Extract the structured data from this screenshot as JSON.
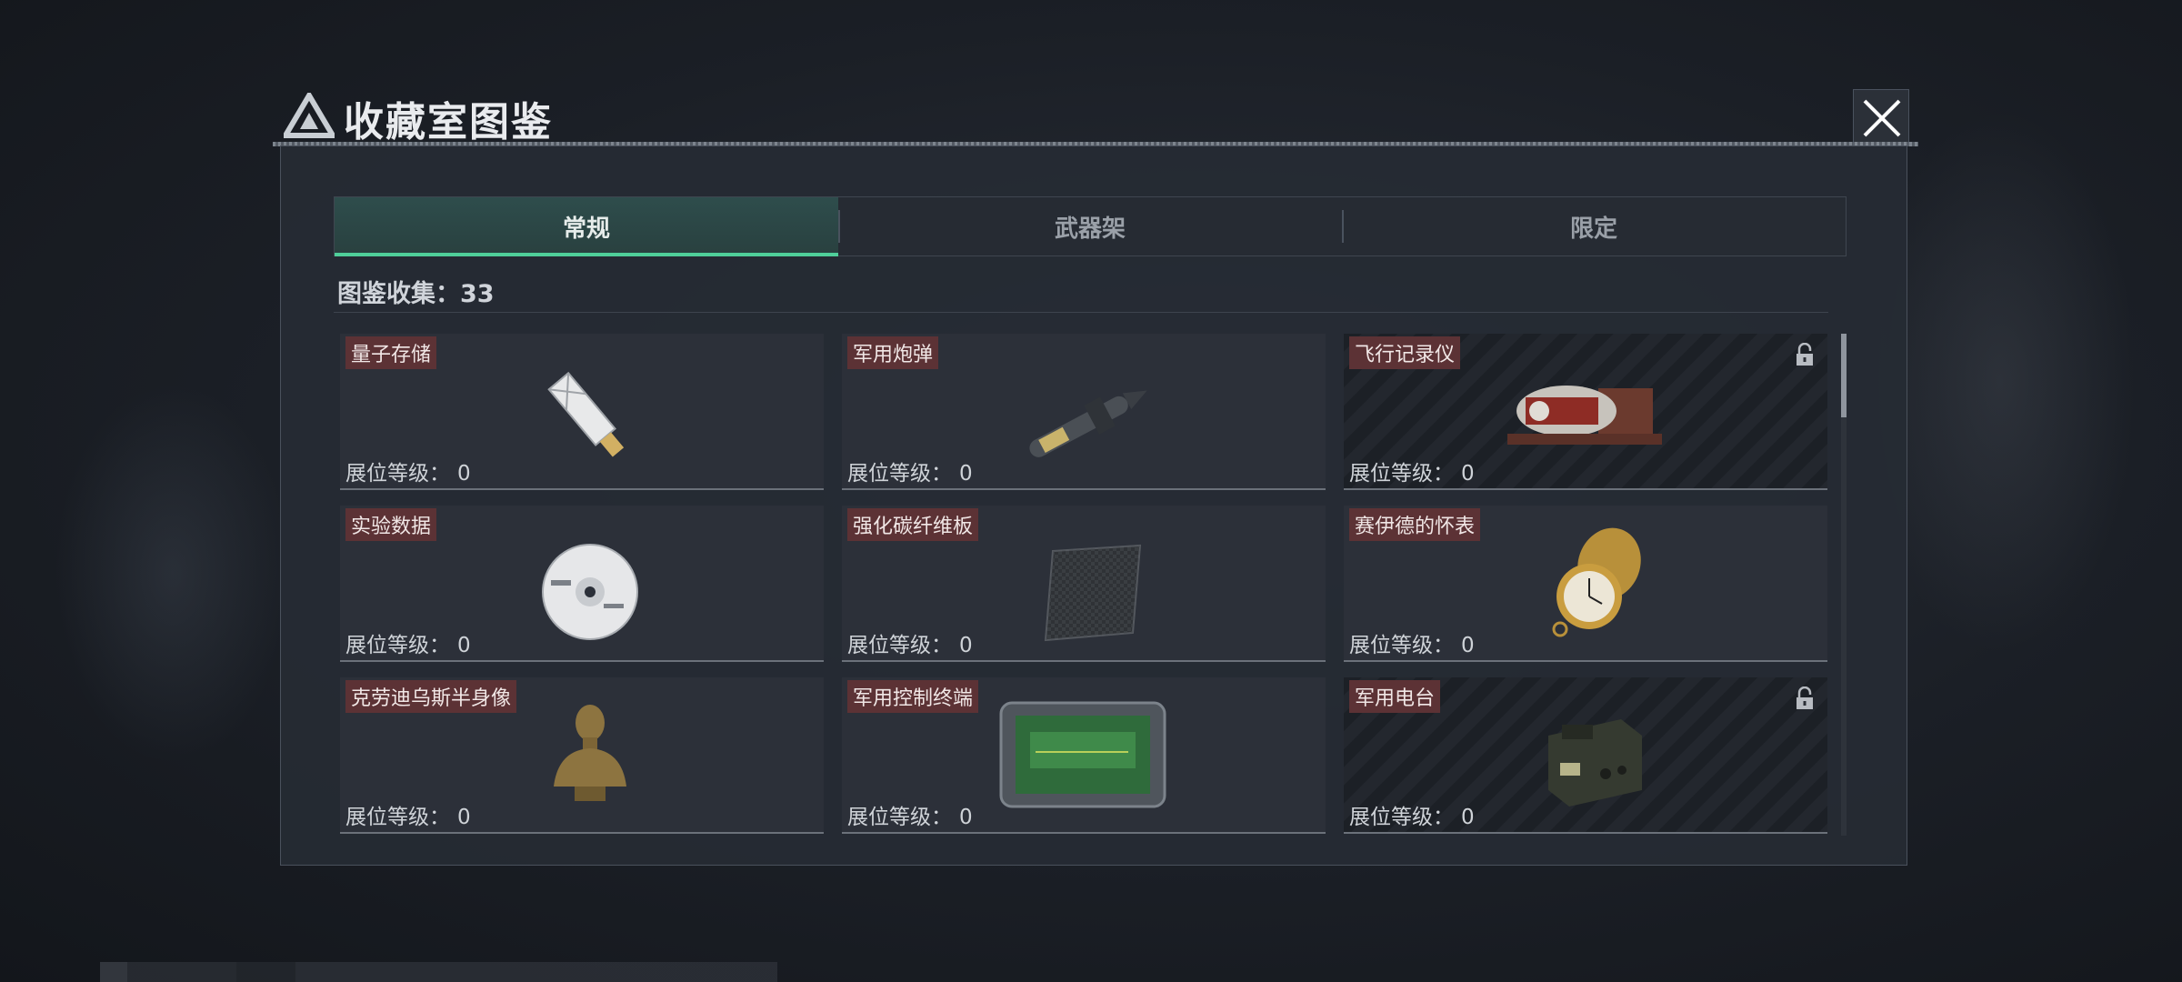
{
  "window": {
    "title": "收藏室图鉴",
    "close_icon": "close-icon"
  },
  "tabs": [
    {
      "label": "常规",
      "active": true
    },
    {
      "label": "武器架",
      "active": false
    },
    {
      "label": "限定",
      "active": false
    }
  ],
  "collection": {
    "label": "图鉴收集：33"
  },
  "items": [
    {
      "name": "量子存储",
      "level_label": "展位等级：",
      "level": "0",
      "locked": false,
      "icon": "usb-drive-icon"
    },
    {
      "name": "军用炮弹",
      "level_label": "展位等级：",
      "level": "0",
      "locked": false,
      "icon": "shell-icon"
    },
    {
      "name": "飞行记录仪",
      "level_label": "展位等级：",
      "level": "0",
      "locked": true,
      "icon": "flight-recorder-icon"
    },
    {
      "name": "实验数据",
      "level_label": "展位等级：",
      "level": "0",
      "locked": false,
      "icon": "disc-icon"
    },
    {
      "name": "强化碳纤维板",
      "level_label": "展位等级：",
      "level": "0",
      "locked": false,
      "icon": "carbon-plate-icon"
    },
    {
      "name": "赛伊德的怀表",
      "level_label": "展位等级：",
      "level": "0",
      "locked": false,
      "icon": "pocket-watch-icon"
    },
    {
      "name": "克劳迪乌斯半身像",
      "level_label": "展位等级：",
      "level": "0",
      "locked": false,
      "icon": "bust-icon"
    },
    {
      "name": "军用控制终端",
      "level_label": "展位等级：",
      "level": "0",
      "locked": false,
      "icon": "terminal-icon"
    },
    {
      "name": "军用电台",
      "level_label": "展位等级：",
      "level": "0",
      "locked": true,
      "icon": "radio-icon"
    }
  ],
  "colors": {
    "accent": "#4fcf9a",
    "label_bg": "#5c3235",
    "panel_bg": "#262b34"
  }
}
